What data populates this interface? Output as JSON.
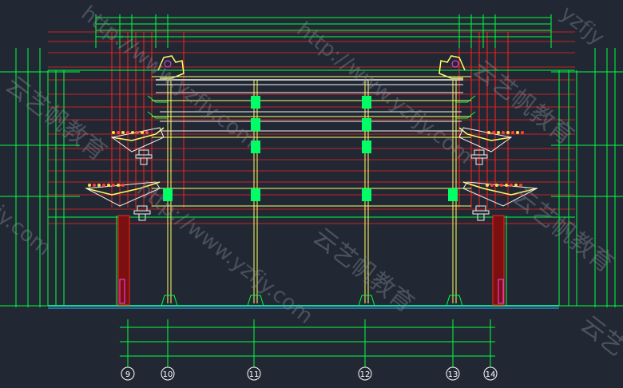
{
  "colors": {
    "background": "#222833",
    "dimension": "#00ff40",
    "gridline": "#ff2020",
    "yellow": "#ffff66",
    "white": "#f2f2f2",
    "ground": "#33aaff",
    "column_fill": "#00ff66",
    "magenta": "#ff44ff"
  },
  "axes": [
    {
      "label": "9"
    },
    {
      "label": "10"
    },
    {
      "label": "11"
    },
    {
      "label": "12"
    },
    {
      "label": "13"
    },
    {
      "label": "14"
    }
  ],
  "watermarks": [
    {
      "text": "http://www.yzfjy.com"
    },
    {
      "text": "云艺帆教育"
    },
    {
      "text": "http://www.yzfjy.com"
    },
    {
      "text": "云艺帆教育"
    },
    {
      "text": "http://www.yzfjy.com"
    },
    {
      "text": "云艺帆教育"
    },
    {
      "text": "yzfjy"
    },
    {
      "text": "jy.com"
    },
    {
      "text": "云艺帆教育"
    },
    {
      "text": "云艺"
    }
  ]
}
